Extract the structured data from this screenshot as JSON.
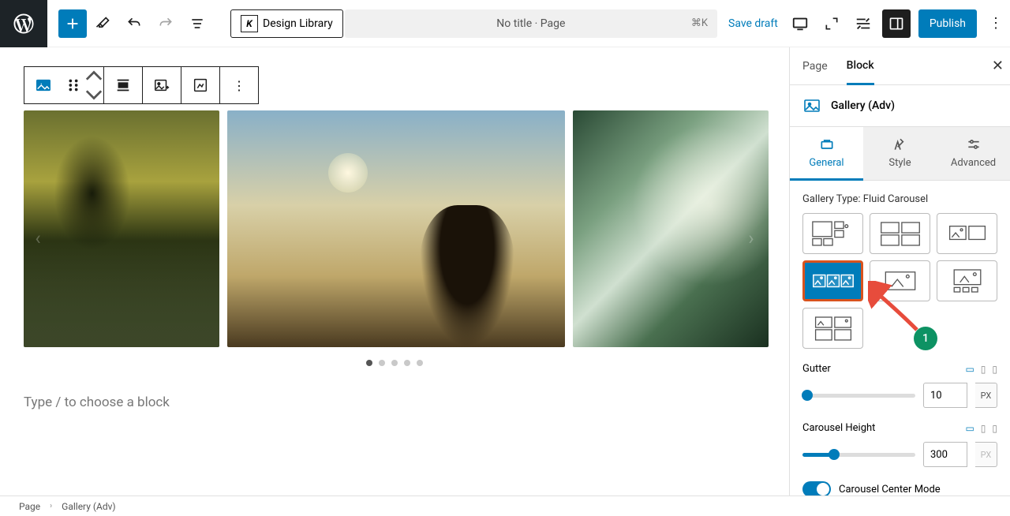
{
  "header": {
    "design_library": "Design Library",
    "page_title": "No title · Page",
    "shortcut": "⌘K",
    "save_draft": "Save draft",
    "publish": "Publish"
  },
  "editor": {
    "placeholder_prompt": "Type / to choose a block",
    "gallery": {
      "active_dot": 0,
      "dot_count": 5
    }
  },
  "sidebar": {
    "tabs": {
      "page": "Page",
      "block": "Block"
    },
    "block_name": "Gallery (Adv)",
    "subtabs": {
      "general": "General",
      "style": "Style",
      "advanced": "Advanced"
    },
    "gallery_type_label": "Gallery Type: Fluid Carousel",
    "gutter": {
      "label": "Gutter",
      "value": "10",
      "unit": "PX"
    },
    "carousel_height": {
      "label": "Carousel Height",
      "value": "300",
      "unit": "PX"
    },
    "carousel_center_mode": "Carousel Center Mode"
  },
  "footer": {
    "crumb_page": "Page",
    "crumb_block": "Gallery (Adv)"
  },
  "annotation": {
    "badge": "1"
  }
}
